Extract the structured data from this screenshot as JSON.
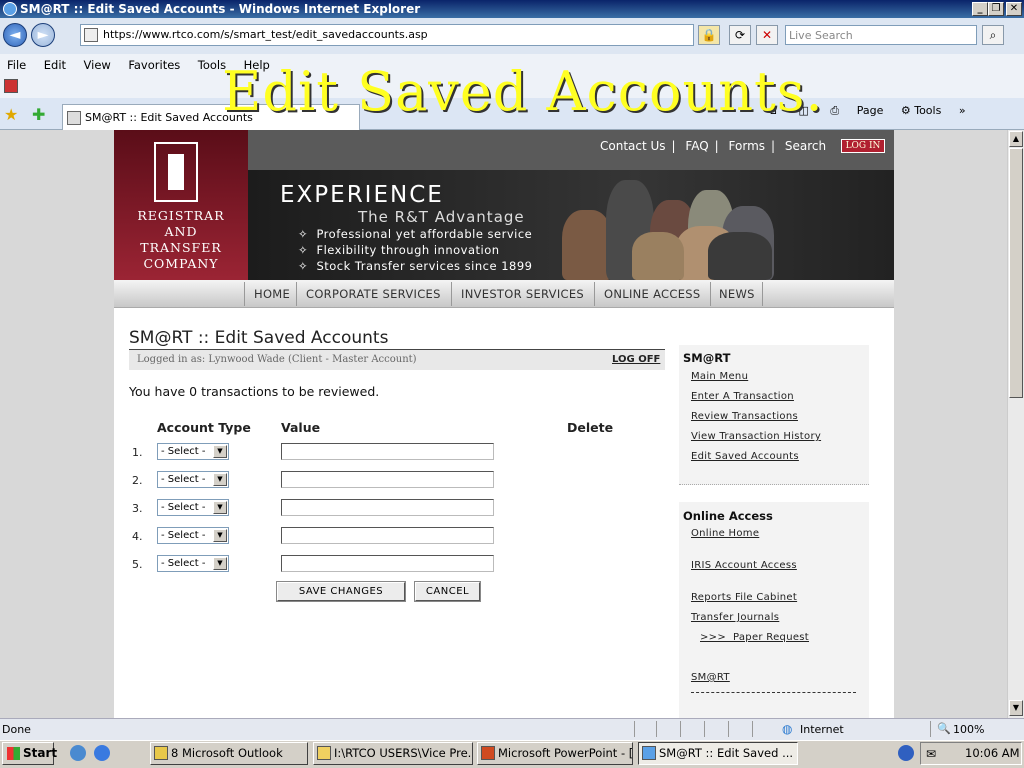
{
  "window": {
    "title": "SM@RT :: Edit Saved Accounts - Windows Internet Explorer",
    "minimize": "_",
    "maximize": "❐",
    "close": "✕"
  },
  "browser": {
    "back": "◄",
    "forward": "►",
    "url": "https://www.rtco.com/s/smart_test/edit_savedaccounts.asp",
    "search_placeholder": "Live Search",
    "menu": [
      "File",
      "Edit",
      "View",
      "Favorites",
      "Tools",
      "Help"
    ],
    "tab_title": "SM@RT :: Edit Saved Accounts",
    "cmd_page": "Page",
    "cmd_tools": "Tools",
    "status": "Done",
    "zone": "Internet",
    "zoom": "100%"
  },
  "overlay_title": "Edit Saved Accounts.",
  "site": {
    "logo_lines": [
      "REGISTRAR",
      "AND",
      "TRANSFER",
      "COMPANY"
    ],
    "top_links": [
      "Contact Us",
      "FAQ",
      "Forms",
      "Search"
    ],
    "login_label": "LOG IN",
    "banner": {
      "headline": "EXPERIENCE",
      "tagline": "The R&T Advantage",
      "bullets": [
        "Professional yet affordable service",
        "Flexibility through innovation",
        "Stock Transfer services since 1899"
      ]
    },
    "nav": [
      "HOME",
      "CORPORATE SERVICES",
      "INVESTOR SERVICES",
      "ONLINE ACCESS",
      "NEWS"
    ]
  },
  "page": {
    "title": "SM@RT :: Edit Saved Accounts",
    "logged_in": "Logged in as: Lynwood Wade (Client - Master Account)",
    "logoff": "LOG OFF",
    "tx_message": "You have 0 transactions to be reviewed.",
    "columns": [
      "Account Type",
      "Value",
      "Delete"
    ],
    "rows": [
      {
        "num": "1.",
        "type": "- Select -",
        "value": ""
      },
      {
        "num": "2.",
        "type": "- Select -",
        "value": ""
      },
      {
        "num": "3.",
        "type": "- Select -",
        "value": ""
      },
      {
        "num": "4.",
        "type": "- Select -",
        "value": ""
      },
      {
        "num": "5.",
        "type": "- Select -",
        "value": ""
      }
    ],
    "save_label": "SAVE CHANGES",
    "cancel_label": "CANCEL"
  },
  "sidebar": {
    "smart_heading": "SM@RT",
    "smart_links": [
      "Main Menu",
      "Enter A Transaction",
      "Review Transactions",
      "View Transaction History",
      "Edit Saved Accounts"
    ],
    "online_heading": "Online Access",
    "online_links": [
      "Online Home",
      "IRIS Account Access",
      "Reports File Cabinet",
      "Transfer Journals",
      ">>>  Paper Request",
      "SM@RT"
    ]
  },
  "taskbar": {
    "start": "Start",
    "tasks": [
      "8 Microsoft Outlook",
      "I:\\RTCO USERS\\Vice Pre...",
      "Microsoft PowerPoint - [...",
      "SM@RT :: Edit Saved ..."
    ],
    "clock": "10:06 AM"
  }
}
